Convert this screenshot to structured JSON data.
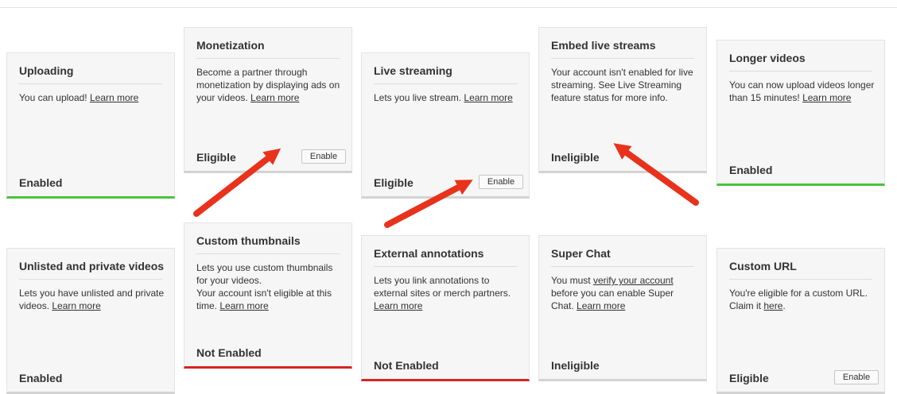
{
  "cards": [
    {
      "title": "Uploading",
      "desc": "You can upload!",
      "link": "Learn more",
      "status": "Enabled"
    },
    {
      "title": "Monetization",
      "desc": "Become a partner through monetization by displaying ads on your videos.",
      "link": "Learn more",
      "status": "Eligible",
      "button": "Enable"
    },
    {
      "title": "Live streaming",
      "desc": "Lets you live stream.",
      "link": "Learn more",
      "status": "Eligible",
      "button": "Enable"
    },
    {
      "title": "Embed live streams",
      "desc": "Your account isn't enabled for live streaming. See Live Streaming feature status for more info.",
      "status": "Ineligible"
    },
    {
      "title": "Longer videos",
      "desc": "You can now upload videos longer than 15 minutes!",
      "link": "Learn more",
      "status": "Enabled"
    },
    {
      "title": "Unlisted and private videos",
      "desc": "Lets you have unlisted and private videos.",
      "link": "Learn more",
      "status": "Enabled"
    },
    {
      "title": "Custom thumbnails",
      "desc_line1": "Lets you use custom thumbnails for your videos.",
      "desc_line2": "Your account isn't eligible at this time.",
      "link": "Learn more",
      "status": "Not Enabled"
    },
    {
      "title": "External annotations",
      "desc": "Lets you link annotations to external sites or merch partners.",
      "link": "Learn more",
      "status": "Not Enabled"
    },
    {
      "title": "Super Chat",
      "desc_pre": "You must",
      "verify_link": "verify your account",
      "desc_post": "before you can enable Super Chat.",
      "link": "Learn more",
      "status": "Ineligible"
    },
    {
      "title": "Custom URL",
      "desc": "You're eligible for a custom URL. Claim it",
      "link": "here",
      "desc_end": ".",
      "status": "Eligible",
      "button": "Enable"
    }
  ],
  "colors": {
    "enabled_bar": "#49c33a",
    "not_enabled_bar": "#d62525",
    "neutral_bar": "#d3d3d3",
    "annotation_arrow": "#e8321c"
  }
}
